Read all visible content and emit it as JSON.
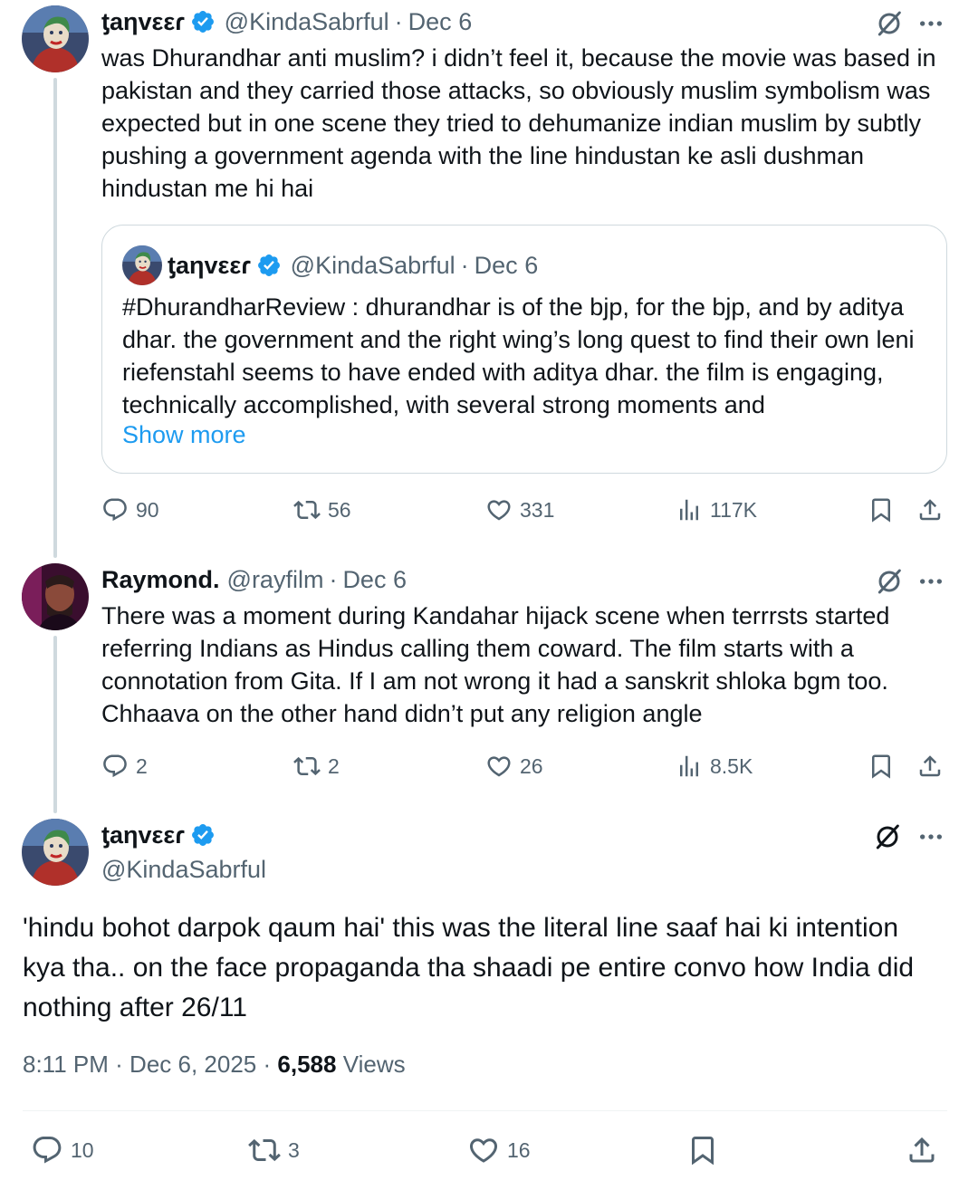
{
  "colors": {
    "accent": "#1d9bf0",
    "text": "#0f1419",
    "muted": "#536471",
    "border": "#cfd9de"
  },
  "tweets": [
    {
      "name": "ƫaηvεεɾ",
      "handle": "@KindaSabrful",
      "sep": "·",
      "date": "Dec 6",
      "verified": true,
      "text": "was Dhurandhar anti muslim? i didn’t feel it, because the movie was based in pakistan and they carried those attacks, so obviously muslim symbolism was expected but in one scene they tried to dehumanize indian muslim by subtly pushing a government agenda with the line hindustan ke asli dushman hindustan me hi hai",
      "quote": {
        "name": "ƫaηvεεɾ",
        "handle": "@KindaSabrful",
        "sep": "·",
        "date": "Dec 6",
        "text": "#DhurandharReview : dhurandhar is of the bjp, for the bjp, and by aditya dhar. the government and the right wing’s long quest to find their own leni riefenstahl seems to have ended with aditya dhar. the film is engaging, technically accomplished, with several strong moments and",
        "show_more": "Show more"
      },
      "stats": {
        "replies": "90",
        "reposts": "56",
        "likes": "331",
        "views": "117K"
      }
    },
    {
      "name": "Raymond.",
      "handle": "@rayfilm",
      "sep": "·",
      "date": "Dec 6",
      "verified": false,
      "text": "There was a moment during Kandahar hijack scene when terrrsts started referring Indians as Hindus calling them coward. The film starts with a connotation from Gita. If I am not wrong it had a sanskrit shloka bgm too. Chhaava on the other hand didn’t put any religion angle",
      "stats": {
        "replies": "2",
        "reposts": "2",
        "likes": "26",
        "views": "8.5K"
      }
    }
  ],
  "main_tweet": {
    "name": "ƫaηvεεɾ",
    "handle": "@KindaSabrful",
    "verified": true,
    "text": "'hindu bohot darpok qaum hai' this was the literal line saaf hai ki intention kya tha.. on the face propaganda tha shaadi pe entire convo how India did nothing after 26/11",
    "time": "8:11 PM",
    "sep": "·",
    "date": "Dec 6, 2025",
    "views_count": "6,588",
    "views_label": "Views",
    "stats": {
      "replies": "10",
      "reposts": "3",
      "likes": "16"
    }
  },
  "icons": [
    "grok-icon",
    "more-icon",
    "reply-icon",
    "repost-icon",
    "like-icon",
    "views-icon",
    "bookmark-icon",
    "share-icon",
    "verified-icon"
  ]
}
